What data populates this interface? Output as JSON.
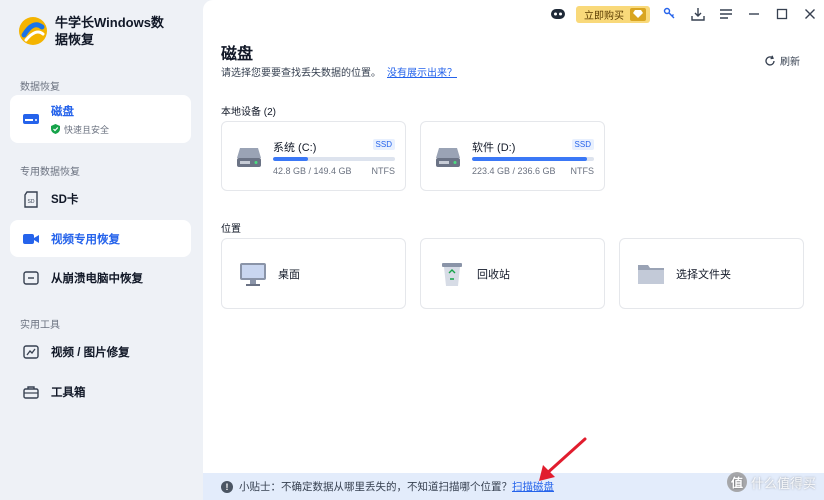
{
  "app": {
    "title": "牛学长Windows数据恢复"
  },
  "sidebar": {
    "sections": [
      {
        "label": "数据恢复"
      },
      {
        "label": "专用数据恢复"
      },
      {
        "label": "实用工具"
      }
    ],
    "items": [
      {
        "label": "磁盘",
        "sub": "快速且安全",
        "icon": "disk-icon"
      },
      {
        "label": "SD卡",
        "icon": "sd-card-icon"
      },
      {
        "label": "视频专用恢复",
        "icon": "video-icon"
      },
      {
        "label": "从崩溃电脑中恢复",
        "icon": "crashed-pc-icon"
      },
      {
        "label": "视频 / 图片修复",
        "icon": "repair-icon"
      },
      {
        "label": "工具箱",
        "icon": "toolbox-icon"
      }
    ]
  },
  "topbar": {
    "buy_label": "立即购买"
  },
  "main": {
    "title": "磁盘",
    "hint": "请选择您要要查找丢失数据的位置。",
    "hint_link": "没有展示出来？",
    "refresh_label": "刷新",
    "local_devices_label": "本地设备 (2)",
    "drives": [
      {
        "name": "系统 (C:)",
        "tag": "SSD",
        "size": "42.8 GB / 149.4 GB",
        "fs": "NTFS",
        "used_fraction": 0.29
      },
      {
        "name": "软件 (D:)",
        "tag": "SSD",
        "size": "223.4 GB / 236.6 GB",
        "fs": "NTFS",
        "used_fraction": 0.94
      }
    ],
    "locations_label": "位置",
    "locations": [
      {
        "label": "桌面",
        "icon": "desktop-icon"
      },
      {
        "label": "回收站",
        "icon": "recycle-bin-icon"
      },
      {
        "label": "选择文件夹",
        "icon": "folder-icon"
      }
    ]
  },
  "tip": {
    "text": "小贴士：不确定数据从哪里丢失的，不知道扫描哪个位置？",
    "link": "扫描磁盘"
  },
  "watermark": {
    "badge": "值",
    "text": "什么值得买"
  },
  "colors": {
    "accent": "#2563eb",
    "sidebar_bg": "#eef1f6",
    "buy": "#f9d97a",
    "tip_bg": "#e3ecfb"
  }
}
